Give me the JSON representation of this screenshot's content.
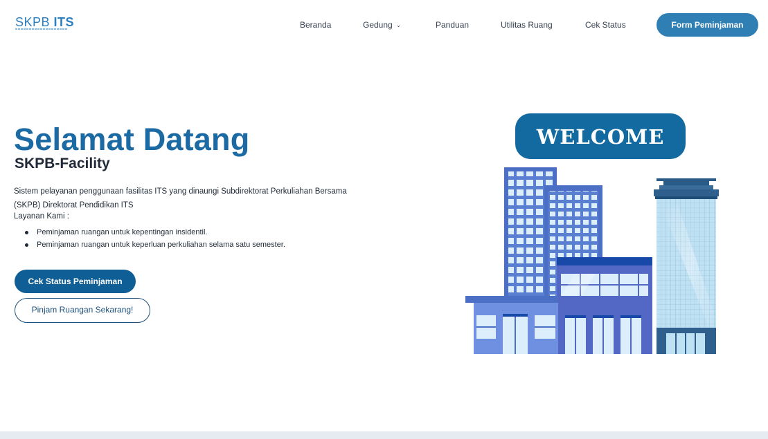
{
  "brand": {
    "logo_text_a": "SKPB ",
    "logo_text_b": "ITS"
  },
  "nav": {
    "items": [
      {
        "label": "Beranda"
      },
      {
        "label": "Gedung",
        "has_dropdown": true
      },
      {
        "label": "Panduan"
      },
      {
        "label": "Utilitas Ruang"
      },
      {
        "label": "Cek Status"
      }
    ],
    "cta_label": "Form Peminjaman"
  },
  "hero": {
    "title": "Selamat Datang",
    "subtitle": "SKPB-Facility",
    "description": "Sistem pelayanan penggunaan fasilitas ITS yang dinaungi Subdirektorat Perkuliahan Bersama (SKPB) Direktorat Pendidikan ITS",
    "services_label": "Layanan Kami :",
    "services": [
      "Peminjaman ruangan untuk kepentingan insidentil.",
      "Peminjaman ruangan untuk keperluan perkuliahan selama satu semester."
    ],
    "primary_button": "Cek Status Peminjaman",
    "secondary_button": "Pinjam Ruangan Sekarang!"
  },
  "illustration": {
    "sign_text": "WELCOME"
  },
  "colors": {
    "primary": "#0f5f96",
    "title": "#1c6aa3",
    "nav_cta": "#2f7fb5",
    "sign": "#136aa0"
  },
  "icons": {
    "gedung_dropdown": "chevron-down-icon"
  }
}
